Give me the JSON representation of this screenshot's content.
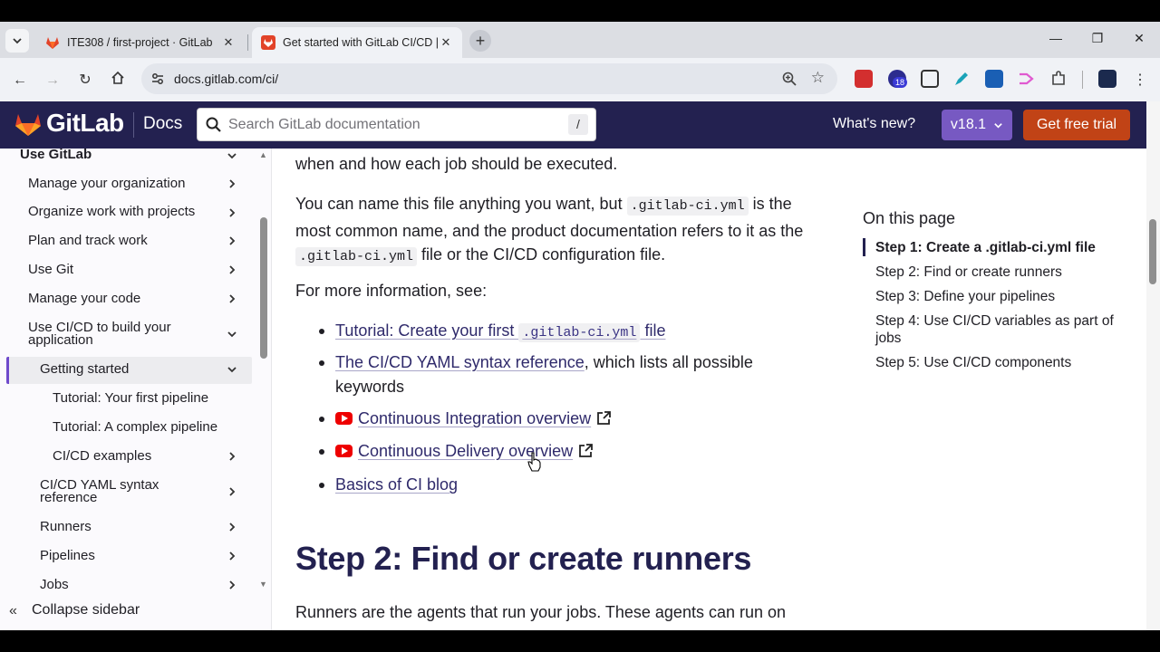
{
  "browser": {
    "tabs": [
      {
        "title": "ITE308 / first-project · GitLab",
        "active": false
      },
      {
        "title": "Get started with GitLab CI/CD |",
        "active": true
      }
    ],
    "new_tab_label": "+",
    "url": "docs.gitlab.com/ci/",
    "extension_badge": "18",
    "window_controls": {
      "minimize": "—",
      "restore": "❐",
      "close": "✕"
    }
  },
  "header": {
    "brand": "GitLab",
    "section": "Docs",
    "search_placeholder": "Search GitLab documentation",
    "search_shortcut": "/",
    "whats_new": "What's new?",
    "version": "v18.1",
    "cta": "Get free trial",
    "colors": {
      "bar": "#232150",
      "version_bg": "#7759c2",
      "cta_bg": "#c14316"
    }
  },
  "sidebar": {
    "items": [
      {
        "label": "Use GitLab",
        "expanded": true
      },
      {
        "label": "Manage your organization"
      },
      {
        "label": "Organize work with projects"
      },
      {
        "label": "Plan and track work"
      },
      {
        "label": "Use Git"
      },
      {
        "label": "Manage your code"
      },
      {
        "label_line1": "Use CI/CD to build your",
        "label_line2": "application",
        "expanded": true
      },
      {
        "label": "Getting started",
        "active": true,
        "expanded": true
      },
      {
        "label": "Tutorial: Your first pipeline"
      },
      {
        "label": "Tutorial: A complex pipeline"
      },
      {
        "label": "CI/CD examples"
      },
      {
        "label_line1": "CI/CD YAML syntax",
        "label_line2": "reference"
      },
      {
        "label": "Runners"
      },
      {
        "label": "Pipelines"
      },
      {
        "label": "Jobs"
      }
    ],
    "collapse_label": "Collapse sidebar"
  },
  "content": {
    "para1": "when and how each job should be executed.",
    "para2": {
      "part1": "You can name this file anything you want, but ",
      "code1": ".gitlab-ci.yml",
      "part2": " is the",
      "line2": "most common name, and the product documentation refers to it as the",
      "code2": ".gitlab-ci.yml",
      "part3": " file or the CI/CD configuration file."
    },
    "para3": "For more information, see:",
    "links": {
      "tutorial_text": "Tutorial: Create your first ",
      "tutorial_code": ".gitlab-ci.yml",
      "tutorial_suffix": " file",
      "yaml_ref": "The CI/CD YAML syntax reference",
      "yaml_ref_suffix": ", which lists all possible",
      "yaml_ref_line2": "keywords",
      "ci_overview": "Continuous Integration overview",
      "cd_overview": "Continuous Delivery overview",
      "blog": "Basics of CI blog"
    },
    "heading": "Step 2: Find or create runners",
    "para4": "Runners are the agents that run your jobs. These agents can run on"
  },
  "toc": {
    "title": "On this page",
    "items": [
      {
        "label": "Step 1: Create a .gitlab-ci.yml file",
        "active": true
      },
      {
        "label": "Step 2: Find or create runners"
      },
      {
        "label": "Step 3: Define your pipelines"
      },
      {
        "label": "Step 4: Use CI/CD variables as part of jobs"
      },
      {
        "label": "Step 5: Use CI/CD components"
      }
    ]
  }
}
